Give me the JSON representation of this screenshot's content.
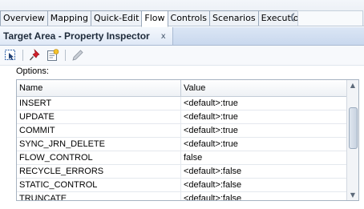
{
  "tabs": [
    {
      "label": "Overview",
      "active": false
    },
    {
      "label": "Mapping",
      "active": false
    },
    {
      "label": "Quick-Edit",
      "active": false
    },
    {
      "label": "Flow",
      "active": true
    },
    {
      "label": "Controls",
      "active": false
    },
    {
      "label": "Scenarios",
      "active": false
    },
    {
      "label": "Execution",
      "active": false
    }
  ],
  "panel": {
    "title": "Target Area - Property Inspector",
    "close_glyph": "x"
  },
  "toolbar": {
    "icons": [
      "select-icon",
      "pin-icon",
      "edit-properties-icon",
      "pencil-icon"
    ]
  },
  "options": {
    "label": "Options:",
    "columns": {
      "name": "Name",
      "value": "Value"
    },
    "rows": [
      {
        "name": "INSERT",
        "value": "<default>:true"
      },
      {
        "name": "UPDATE",
        "value": "<default>:true"
      },
      {
        "name": "COMMIT",
        "value": "<default>:true"
      },
      {
        "name": "SYNC_JRN_DELETE",
        "value": "<default>:true"
      },
      {
        "name": "FLOW_CONTROL",
        "value": "false"
      },
      {
        "name": "RECYCLE_ERRORS",
        "value": "<default>:false"
      },
      {
        "name": "STATIC_CONTROL",
        "value": "<default>:false"
      },
      {
        "name": "TRUNCATE",
        "value": "<default>:false"
      }
    ]
  },
  "colors": {
    "panel_header": "#c9d8ee",
    "accent_blue": "#1f5fb5",
    "pin_red": "#d0202a"
  }
}
